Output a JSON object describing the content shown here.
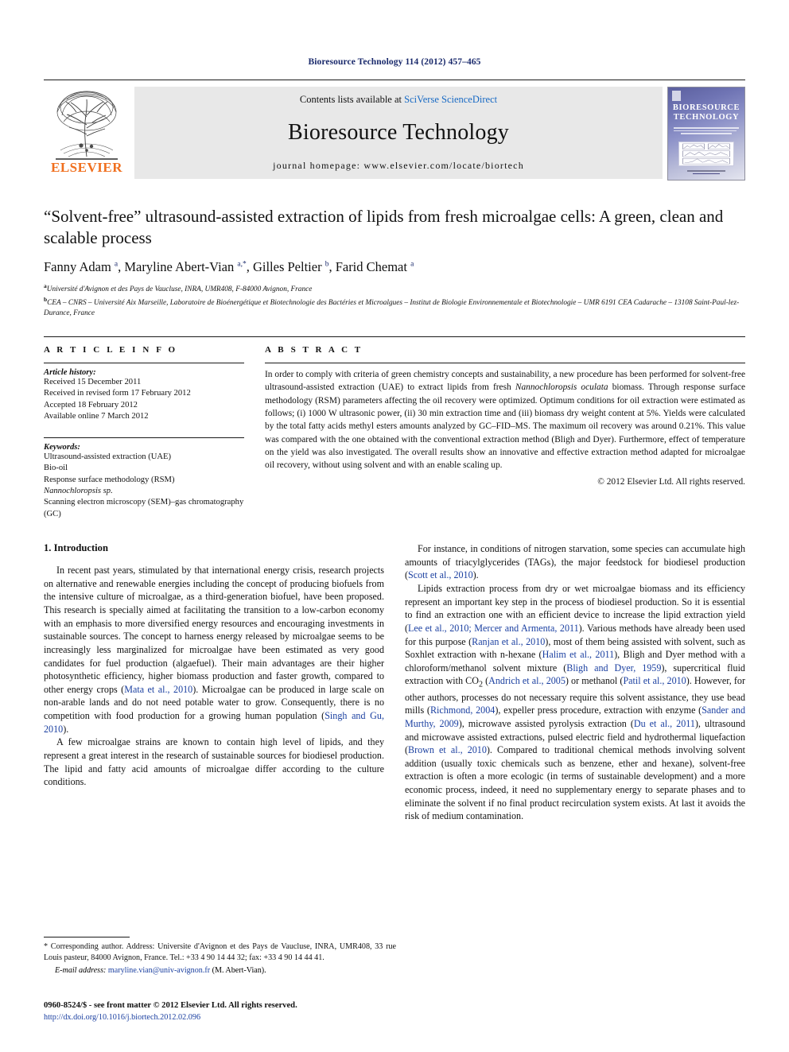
{
  "running_head": "Bioresource Technology 114 (2012) 457–465",
  "masthead": {
    "publisher_name": "ELSEVIER",
    "contents_prefix": "Contents lists available at ",
    "contents_link": "SciVerse ScienceDirect",
    "journal_title": "Bioresource Technology",
    "homepage": "journal homepage: www.elsevier.com/locate/biortech",
    "cover_title": "BIORESOURCE TECHNOLOGY"
  },
  "article": {
    "title": "“Solvent-free” ultrasound-assisted extraction of lipids from fresh microalgae cells: A green, clean and scalable process",
    "authors_html": "Fanny Adam <sup>a</sup>, Maryline Abert-Vian <sup>a,*</sup>, Gilles Peltier <sup>b</sup>, Farid Chemat <sup>a</sup>",
    "affiliation_a": "Université d'Avignon et des Pays de Vaucluse, INRA, UMR408, F-84000 Avignon, France",
    "affiliation_b": "CEA – CNRS – Université Aix Marseille, Laboratoire de Bioénergétique et Biotechnologie des Bactéries et Microalgues – Institut de Biologie Environnementale et Biotechnologie – UMR 6191 CEA Cadarache – 13108 Saint-Paul-lez-Durance, France"
  },
  "info": {
    "heading": "A R T I C L E   I N F O",
    "history_label": "Article history:",
    "history": [
      "Received 15 December 2011",
      "Received in revised form 17 February 2012",
      "Accepted 18 February 2012",
      "Available online 7 March 2012"
    ],
    "keywords_label": "Keywords:",
    "keywords": [
      "Ultrasound-assisted extraction (UAE)",
      "Bio-oil",
      "Response surface methodology (RSM)",
      "Nannochloropsis sp.",
      "Scanning electron microscopy (SEM)–gas chromatography (GC)"
    ],
    "keyword_italic_index": 3
  },
  "abstract": {
    "heading": "A B S T R A C T",
    "text_html": "In order to comply with criteria of green chemistry concepts and sustainability, a new procedure has been performed for solvent-free ultrasound-assisted extraction (UAE) to extract lipids from fresh <i>Nannochloropsis oculata</i> biomass. Through response surface methodology (RSM) parameters affecting the oil recovery were optimized. Optimum conditions for oil extraction were estimated as follows; (i) 1000 W ultrasonic power, (ii) 30 min extraction time and (iii) biomass dry weight content at 5%. Yields were calculated by the total fatty acids methyl esters amounts analyzed by GC–FID–MS. The maximum oil recovery was around 0.21%. This value was compared with the one obtained with the conventional extraction method (Bligh and Dyer). Furthermore, effect of temperature on the yield was also investigated. The overall results show an innovative and effective extraction method adapted for microalgae oil recovery, without using solvent and with an enable scaling up.",
    "copyright": "© 2012 Elsevier Ltd. All rights reserved."
  },
  "body": {
    "section_title": "1. Introduction",
    "left_paragraphs_html": [
      "In recent past years, stimulated by that international energy crisis, research projects on alternative and renewable energies including the concept of producing biofuels from the intensive culture of microalgae, as a third-generation biofuel, have been proposed. This research is specially aimed at facilitating the transition to a low-carbon economy with an emphasis to more diversified energy resources and encouraging investments in sustainable sources. The concept to harness energy released by microalgae seems to be increasingly less marginalized for microalgae have been estimated as very good candidates for fuel production (algaefuel). Their main advantages are their higher photosynthetic efficiency, higher biomass production and faster growth, compared to other energy crops (<span class=\"cite\">Mata et al., 2010</span>). Microalgae can be produced in large scale on non-arable lands and do not need potable water to grow. Consequently, there is no competition with food production for a growing human population (<span class=\"cite\">Singh and Gu, 2010</span>).",
      "A few microalgae strains are known to contain high level of lipids, and they represent a great interest in the research of sustainable sources for biodiesel production. The lipid and fatty acid amounts of microalgae differ according to the culture conditions."
    ],
    "right_paragraphs_html": [
      "For instance, in conditions of nitrogen starvation, some species can accumulate high amounts of triacylglycerides (TAGs), the major feedstock for biodiesel production (<span class=\"cite\">Scott et al., 2010</span>).",
      "Lipids extraction process from dry or wet microalgae biomass and its efficiency represent an important key step in the process of biodiesel production. So it is essential to find an extraction one with an efficient device to increase the lipid extraction yield (<span class=\"cite\">Lee et al., 2010; Mercer and Armenta, 2011</span>). Various methods have already been used for this purpose (<span class=\"cite\">Ranjan et al., 2010</span>), most of them being assisted with solvent, such as Soxhlet extraction with n-hexane (<span class=\"cite\">Halim et al., 2011</span>), Bligh and Dyer method with a chloroform/methanol solvent mixture (<span class=\"cite\">Bligh and Dyer, 1959</span>), supercritical fluid extraction with CO<sub>2</sub> (<span class=\"cite\">Andrich et al., 2005</span>) or methanol (<span class=\"cite\">Patil et al., 2010</span>). However, for other authors, processes do not necessary require this solvent assistance, they use bead mills (<span class=\"cite\">Richmond, 2004</span>), expeller press procedure, extraction with enzyme (<span class=\"cite\">Sander and Murthy, 2009</span>), microwave assisted pyrolysis extraction (<span class=\"cite\">Du et al., 2011</span>), ultrasound and microwave assisted extractions, pulsed electric field and hydrothermal liquefaction (<span class=\"cite\">Brown et al., 2010</span>). Compared to traditional chemical methods involving solvent addition (usually toxic chemicals such as benzene, ether and hexane), solvent-free extraction is often a more ecologic (in terms of sustainable development) and a more economic process, indeed, it need no supplementary energy to separate phases and to eliminate the solvent if no final product recirculation system exists. At last it avoids the risk of medium contamination."
    ]
  },
  "footnote": {
    "corresponding_html": "* Corresponding author. Address: Universite d'Avignon et des Pays de Vaucluse, INRA, UMR408, 33 rue Louis pasteur, 84000 Avignon, France. Tel.: +33 4 90 14 44 32; fax: +33 4 90 14 44 41.",
    "email_label": "E-mail address:",
    "email": "maryline.vian@univ-avignon.fr",
    "email_owner": "(M. Abert-Vian)."
  },
  "footer": {
    "issn_line": "0960-8524/$ - see front matter © 2012 Elsevier Ltd. All rights reserved.",
    "doi_line": "http://dx.doi.org/10.1016/j.biortech.2012.02.096"
  },
  "colors": {
    "link": "#1769c4",
    "citation": "#1a3fa0",
    "running_head": "#1a2a6c",
    "elsevier_orange": "#F06F1E"
  }
}
